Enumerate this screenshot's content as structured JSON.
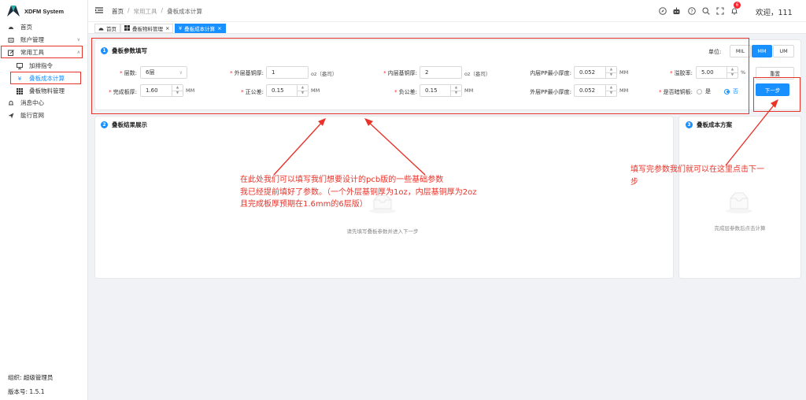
{
  "app": {
    "name": "XDFM System"
  },
  "sidebar": {
    "items": [
      {
        "label": "首页",
        "icon": "dashboard-icon"
      },
      {
        "label": "账户管理",
        "icon": "account-icon"
      },
      {
        "label": "常用工具",
        "icon": "tools-icon"
      },
      {
        "label": "加排指令",
        "icon": "command-icon"
      },
      {
        "label": "叠板成本计算",
        "icon": "yen-icon"
      },
      {
        "label": "叠板物料管理",
        "icon": "grid-icon"
      },
      {
        "label": "消息中心",
        "icon": "bell-icon"
      },
      {
        "label": "能行官网",
        "icon": "send-icon"
      }
    ],
    "org": "组织: 超级管理员",
    "version": "版本号: 1.5.1"
  },
  "header": {
    "breadcrumb": [
      "首页",
      "/",
      "常用工具",
      "/",
      "叠板成本计算"
    ],
    "notification_count": "6",
    "welcome": "欢迎，111"
  },
  "tags": [
    {
      "label": "首页"
    },
    {
      "label": "叠板物料管理",
      "close": "×"
    },
    {
      "label": "叠板成本计算",
      "close": "×"
    }
  ],
  "params": {
    "step": "1",
    "title": "叠板参数填写",
    "unit_label": "单位:",
    "units": [
      "MIL",
      "MM",
      "UM"
    ],
    "active_unit": "MM",
    "reset": "重置",
    "next": "下一步",
    "fields": {
      "layers": {
        "label": "层数:",
        "value": "6层"
      },
      "outer_cu": {
        "label": "外层基铜厚:",
        "value": "1",
        "unit": "oz（盎司）"
      },
      "inner_cu": {
        "label": "内层基铜厚:",
        "value": "2",
        "unit": "oz（盎司）"
      },
      "inner_pp": {
        "label": "内层PP最小厚度:",
        "value": "0.052",
        "unit": "MM"
      },
      "overflow": {
        "label": "溢胶率:",
        "value": "5.00",
        "unit": "%"
      },
      "thickness": {
        "label": "完成板厚:",
        "value": "1.60",
        "unit": "MM"
      },
      "pos_tol": {
        "label": "正公差:",
        "value": "0.15",
        "unit": "MM"
      },
      "neg_tol": {
        "label": "负公差:",
        "value": "0.15",
        "unit": "MM"
      },
      "outer_pp": {
        "label": "外层PP最小厚度:",
        "value": "0.052",
        "unit": "MM"
      },
      "buried": {
        "label": "是否暗铜板:",
        "yes": "是",
        "no": "否",
        "selected": "否"
      }
    }
  },
  "result": {
    "step": "2",
    "title": "叠板结果展示",
    "empty": "请先填写叠板参数并进入下一步"
  },
  "cost": {
    "step": "3",
    "title": "叠板成本方案",
    "empty": "完成层参数后点击计算"
  },
  "annotations": {
    "left": [
      "在此处我们可以填写我们想要设计的pcb版的一些基础参数",
      "我已经提前填好了参数。（一个外层基铜厚为1oz，内层基铜厚为2oz",
      "且完成板厚预期在1.6mm的6层版）"
    ],
    "right": [
      "填写完参数我们就可以在这里点击下一",
      "步"
    ]
  },
  "colors": {
    "accent": "#1890ff",
    "annotation": "#e8332a"
  }
}
